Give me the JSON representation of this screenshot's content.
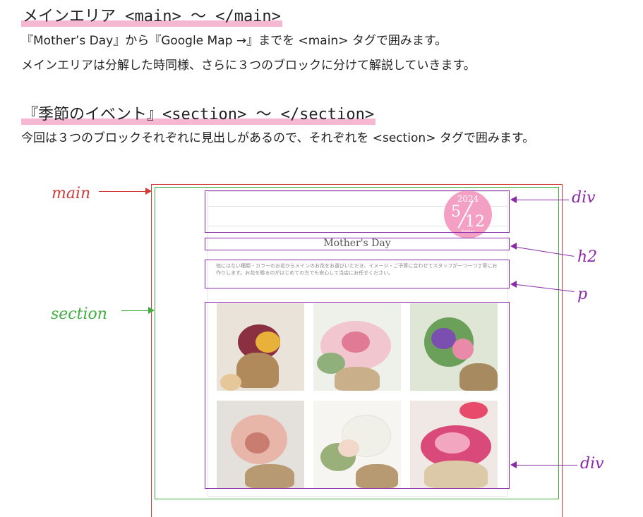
{
  "section1": {
    "heading": "メインエリア <main> ～ </main>",
    "line1": "『Mother’s Day』から『Google Map →』までを <main> タグで囲みます。",
    "line2": "メインエリアは分解した時同様、さらに３つのブロックに分けて解説していきます。"
  },
  "section2": {
    "heading": "『季節のイベント』<section> ～ </section>",
    "line1": "今回は３つのブロックそれぞれに見出しがあるので、それぞれを <section> タグで囲みます。"
  },
  "mock": {
    "date_year": "2024",
    "date_day": "5",
    "date_month": "12",
    "date_sub": "Sunday",
    "h2_title": "Mother's Day",
    "p_text": "他にはない種類・カラーのお花からメインのお花をお選びいただき、イメージ・ご予算に合わせてスタッフが一つ一つ丁寧にお作りします。お花を贈るのがはじめての方でも安心して当店にお任せください。"
  },
  "annotations": {
    "main": "main",
    "section": "section",
    "div_top": "div",
    "h2": "h2",
    "p": "p",
    "div_bottom": "div"
  },
  "colors": {
    "main": "#d23a3a",
    "section": "#3fae3f",
    "inner": "#8a2aa8",
    "highlight": "#f6b7d2",
    "date_circle": "#f4a0c4"
  }
}
